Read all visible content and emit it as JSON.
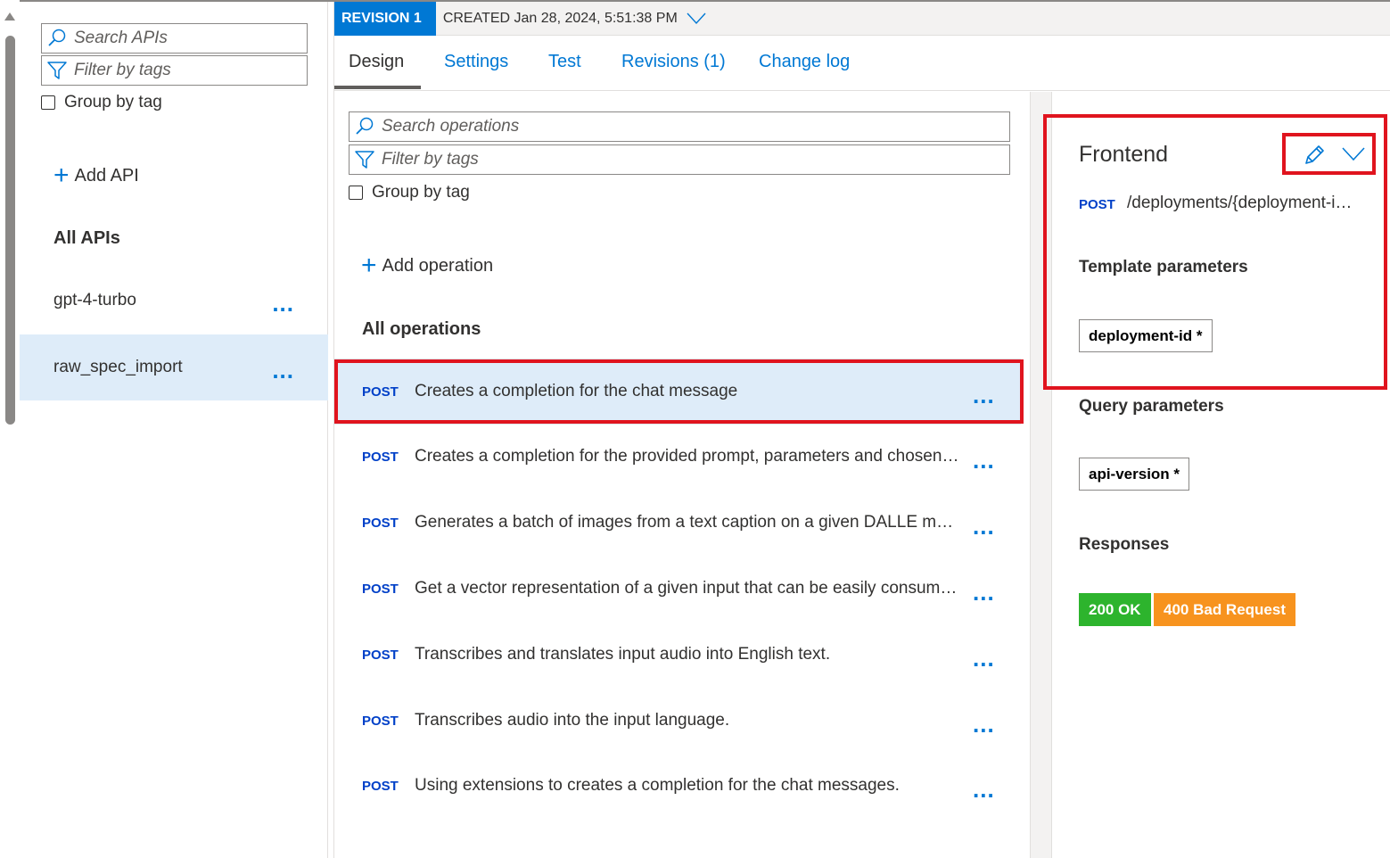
{
  "left": {
    "search_placeholder": "Search APIs",
    "filter_placeholder": "Filter by tags",
    "group_by_tag": "Group by tag",
    "add_api": "Add API",
    "all_apis": "All APIs",
    "apis": [
      {
        "name": "gpt-4-turbo",
        "more": "..."
      },
      {
        "name": "raw_spec_import",
        "more": "..."
      }
    ]
  },
  "revision": {
    "badge": "REVISION 1",
    "created": "CREATED Jan 28, 2024, 5:51:38 PM"
  },
  "tabs": [
    "Design",
    "Settings",
    "Test",
    "Revisions (1)",
    "Change log"
  ],
  "operations": {
    "search_placeholder": "Search operations",
    "filter_placeholder": "Filter by tags",
    "group_by_tag": "Group by tag",
    "add_operation": "Add operation",
    "all_operations": "All operations",
    "items": [
      {
        "verb": "POST",
        "desc": "Creates a completion for the chat message",
        "more": "..."
      },
      {
        "verb": "POST",
        "desc": "Creates a completion for the provided prompt, parameters and chosen model.",
        "more": "..."
      },
      {
        "verb": "POST",
        "desc": "Generates a batch of images from a text caption on a given DALLE model deployment",
        "more": "..."
      },
      {
        "verb": "POST",
        "desc": "Get a vector representation of a given input that can be easily consumed by machine learning models",
        "more": "..."
      },
      {
        "verb": "POST",
        "desc": "Transcribes and translates input audio into English text.",
        "more": "..."
      },
      {
        "verb": "POST",
        "desc": "Transcribes audio into the input language.",
        "more": "..."
      },
      {
        "verb": "POST",
        "desc": "Using extensions to creates a completion for the chat messages.",
        "more": "..."
      }
    ]
  },
  "frontend": {
    "title": "Frontend",
    "verb": "POST",
    "path": "/deployments/{deployment-id}/chat/completions",
    "template_parameters": "Template parameters",
    "template_param": "deployment-id *",
    "query_parameters": "Query parameters",
    "query_param": "api-version *",
    "responses": "Responses",
    "response_ok": "200 OK",
    "response_bad": "400 Bad Request"
  },
  "colors": {
    "accent": "#0078d4",
    "selected_bg": "#deecf9",
    "highlight": "#e0141e",
    "ok": "#2db42d",
    "bad_request": "#f7931e"
  }
}
